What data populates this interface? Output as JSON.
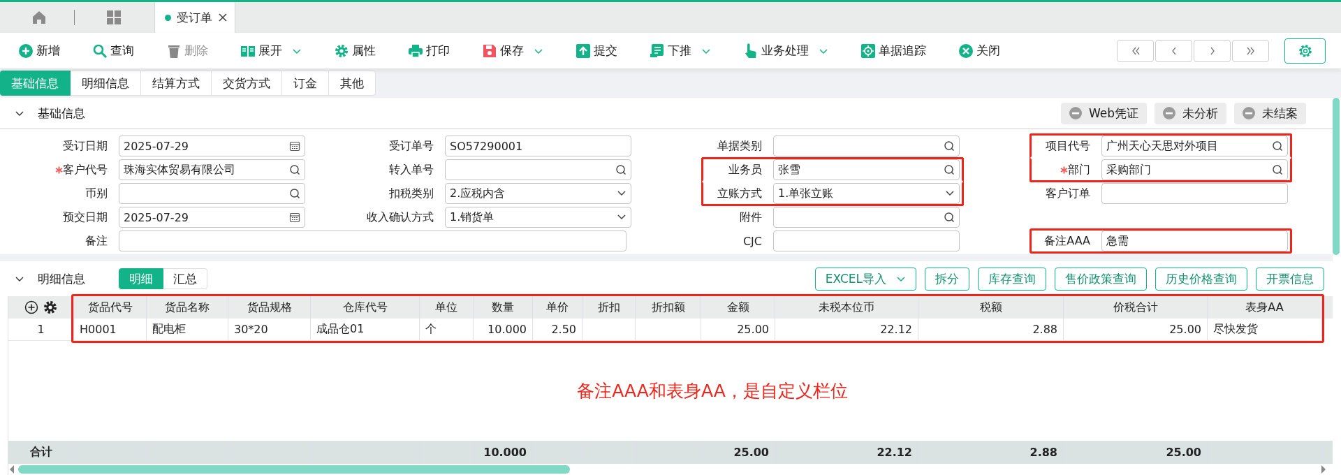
{
  "page_tabs": [
    {
      "label": "受订单",
      "selected": true
    }
  ],
  "toolbar": [
    {
      "label": "新增",
      "disabled": false,
      "dropdown": false
    },
    {
      "label": "查询",
      "disabled": false,
      "dropdown": false
    },
    {
      "label": "删除",
      "disabled": true,
      "dropdown": false
    },
    {
      "label": "展开",
      "disabled": false,
      "dropdown": true
    },
    {
      "label": "属性",
      "disabled": false,
      "dropdown": false
    },
    {
      "label": "打印",
      "disabled": false,
      "dropdown": false
    },
    {
      "label": "保存",
      "disabled": false,
      "dropdown": true
    },
    {
      "label": "提交",
      "disabled": false,
      "dropdown": false
    },
    {
      "label": "下推",
      "disabled": false,
      "dropdown": true
    },
    {
      "label": "业务处理",
      "disabled": false,
      "dropdown": true
    },
    {
      "label": "单据追踪",
      "disabled": false,
      "dropdown": false
    },
    {
      "label": "关闭",
      "disabled": false,
      "dropdown": false
    }
  ],
  "form_tabs": [
    {
      "label": "基础信息",
      "selected": true
    },
    {
      "label": "明细信息",
      "selected": false
    },
    {
      "label": "结算方式",
      "selected": false
    },
    {
      "label": "交货方式",
      "selected": false
    },
    {
      "label": "订金",
      "selected": false
    },
    {
      "label": "其他",
      "selected": false
    }
  ],
  "basic_section": {
    "title": "基础信息",
    "expanded": true,
    "status_buttons": [
      "Web凭证",
      "未分析",
      "未结案"
    ],
    "rows": [
      [
        {
          "label": "受订日期",
          "value": "2025-07-29",
          "kind": "date",
          "required": false,
          "highlighted": false
        },
        {
          "label": "受订单号",
          "value": "SO57290001",
          "kind": "text",
          "required": false,
          "highlighted": false
        },
        {
          "label": "单据类别",
          "kind": "lookup",
          "required": false,
          "highlighted": false
        },
        {
          "label": "项目代号",
          "value": "广州天心天思对外项目",
          "kind": "lookup",
          "required": false,
          "highlighted": true
        }
      ],
      [
        {
          "label": "客户代号",
          "value": "珠海实体贸易有限公司",
          "kind": "lookup",
          "required": true,
          "highlighted": false
        },
        {
          "label": "转入单号",
          "kind": "lookup",
          "required": false,
          "highlighted": false
        },
        {
          "label": "业务员",
          "value": "张雪",
          "kind": "lookup",
          "required": false,
          "highlighted": true
        },
        {
          "label": "部门",
          "value": "采购部门",
          "kind": "lookup",
          "required": true,
          "highlighted": true
        }
      ],
      [
        {
          "label": "币别",
          "kind": "lookup",
          "required": false,
          "highlighted": false
        },
        {
          "label": "扣税类别",
          "value": "2.应税内含",
          "kind": "select",
          "required": false,
          "highlighted": false
        },
        {
          "label": "立账方式",
          "value": "1.单张立账",
          "kind": "select",
          "required": false,
          "highlighted": true
        },
        {
          "label": "客户订单",
          "kind": "text",
          "required": false,
          "highlighted": false
        }
      ],
      [
        {
          "label": "预交日期",
          "value": "2025-07-29",
          "kind": "date",
          "required": false,
          "highlighted": false
        },
        {
          "label": "收入确认方式",
          "value": "1.销货单",
          "kind": "select",
          "required": false,
          "highlighted": false
        },
        {
          "label": "附件",
          "kind": "lookup",
          "required": false,
          "highlighted": false
        }
      ],
      [
        {
          "label": "备注",
          "kind": "text",
          "wide": true,
          "required": false,
          "highlighted": false
        },
        "",
        {
          "label": "CJC",
          "kind": "text",
          "required": false,
          "highlighted": false
        },
        {
          "label": "备注AAA",
          "value": "急需",
          "kind": "text",
          "required": false,
          "highlighted": true
        }
      ]
    ]
  },
  "detail_section": {
    "title": "明细信息",
    "expanded": true,
    "view_tabs": [
      {
        "label": "明细",
        "selected": true
      },
      {
        "label": "汇总",
        "selected": false
      }
    ],
    "buttons": [
      {
        "label": "EXCEL导入",
        "dropdown": true
      },
      {
        "label": "拆分",
        "dropdown": false
      },
      {
        "label": "库存查询",
        "dropdown": false
      },
      {
        "label": "售价政策查询",
        "dropdown": false
      },
      {
        "label": "历史价格查询",
        "dropdown": false
      },
      {
        "label": "开票信息",
        "dropdown": false
      }
    ],
    "grid": {
      "highlighted": true,
      "total_label": "合计",
      "columns": [
        {
          "title": "货品代号",
          "numeric": false
        },
        {
          "title": "货品名称",
          "numeric": false
        },
        {
          "title": "货品规格",
          "numeric": false
        },
        {
          "title": "仓库代号",
          "numeric": false
        },
        {
          "title": "单位",
          "numeric": false
        },
        {
          "title": "数量",
          "numeric": true,
          "total": "10.000"
        },
        {
          "title": "单价",
          "numeric": true
        },
        {
          "title": "折扣"
        },
        {
          "title": "折扣额"
        },
        {
          "title": "金额",
          "numeric": true,
          "total": "25.00"
        },
        {
          "title": "未税本位币",
          "numeric": true,
          "total": "22.12"
        },
        {
          "title": "税额",
          "numeric": true,
          "total": "2.88"
        },
        {
          "title": "价税合计",
          "numeric": true,
          "total": "25.00"
        },
        {
          "title": "表身AA",
          "numeric": false
        }
      ],
      "rows": [
        {
          "no": "1",
          "cells": [
            "H0001",
            "配电柜",
            "30*20",
            "成品仓01",
            "个",
            "10.000",
            "2.50",
            null,
            null,
            "25.00",
            "22.12",
            "2.88",
            "25.00",
            "尽快发货"
          ]
        }
      ]
    },
    "annotation_note": "备注AAA和表身AA，是自定义栏位"
  }
}
